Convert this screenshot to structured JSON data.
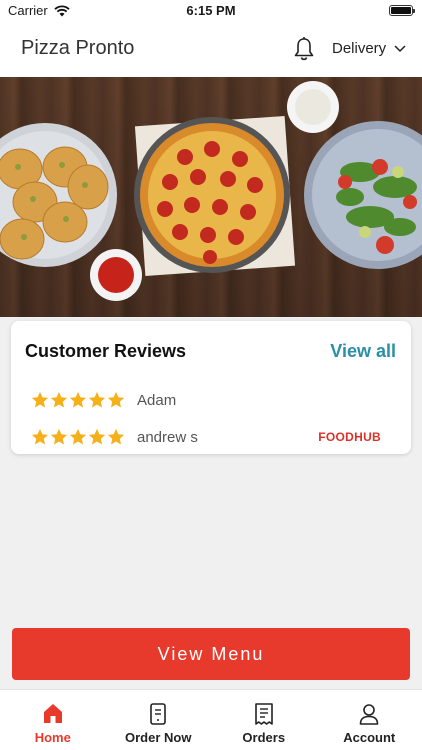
{
  "status_bar": {
    "carrier": "Carrier",
    "time": "6:15 PM",
    "wifi_icon": "wifi-icon",
    "battery_icon": "battery-icon"
  },
  "header": {
    "title": "Pizza Pronto",
    "mode": "Delivery",
    "bell_icon": "bell-icon",
    "dropdown_icon": "chevron-down-icon"
  },
  "hero": {
    "image": "food-banner-pizza-garlic-bread-salad"
  },
  "reviews": {
    "title": "Customer Reviews",
    "view_all": "View all",
    "items": [
      {
        "name": "Adam",
        "rating": 5
      },
      {
        "name": "andrew s",
        "rating": 5
      }
    ],
    "source": "FOODHUB"
  },
  "actions": {
    "view_menu": "View Menu"
  },
  "tabs": [
    {
      "label": "Home",
      "icon": "home-icon",
      "active": true
    },
    {
      "label": "Order Now",
      "icon": "order-icon",
      "active": false
    },
    {
      "label": "Orders",
      "icon": "receipt-icon",
      "active": false
    },
    {
      "label": "Account",
      "icon": "user-icon",
      "active": false
    }
  ],
  "colors": {
    "accent": "#e83a2c",
    "link": "#2a8fa8",
    "star": "#f5b01a"
  }
}
